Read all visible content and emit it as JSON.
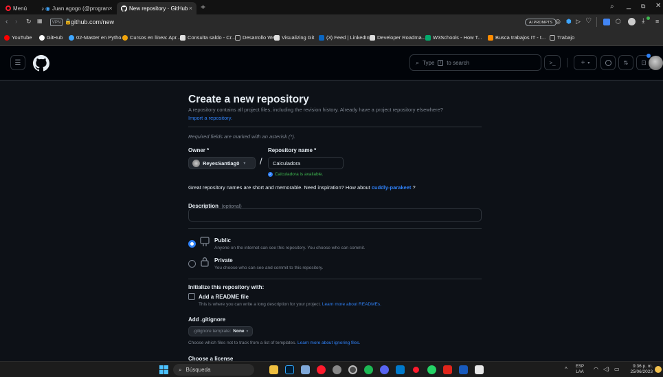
{
  "browser": {
    "menu_label": "Menú",
    "tabs": [
      {
        "label": "Juan agogo (@progran"
      },
      {
        "label": "New repository · GitHub"
      }
    ],
    "url": "github.com/new",
    "vpn_label": "VPN",
    "ai_prompts_label": "AI PROMPTS",
    "bookmarks": [
      {
        "label": "YouTube",
        "color": "#ff0000"
      },
      {
        "label": "GitHub",
        "color": "#ffffff"
      },
      {
        "label": "02-Master en Pytho...",
        "color": "#3ea6ff"
      },
      {
        "label": "Cursos en línea: Apr...",
        "color": "#f0a30a"
      },
      {
        "label": "Consulta saldo - Cr...",
        "color": "#e0e0e0"
      },
      {
        "label": "Desarrollo Web",
        "color": "#bbbbbb"
      },
      {
        "label": "Visualizing Git",
        "color": "#e0e0e0"
      },
      {
        "label": "(3) Feed | LinkedIn",
        "color": "#0a66c2"
      },
      {
        "label": "Developer Roadma...",
        "color": "#dddddd"
      },
      {
        "label": "W3Schools - How T...",
        "color": "#04aa6d"
      },
      {
        "label": "Busca trabajos IT - t...",
        "color": "#ff8c00"
      },
      {
        "label": "Trabajo",
        "color": "#bbbbbb"
      }
    ]
  },
  "github_header": {
    "search_placeholder": "Type / to search",
    "search_prefix": "Type",
    "search_key": "/",
    "search_suffix": "to search"
  },
  "form": {
    "title": "Create a new repository",
    "subtitle": "A repository contains all project files, including the revision history. Already have a project repository elsewhere?",
    "import_link": "Import a repository.",
    "required_note": "Required fields are marked with an asterisk (*).",
    "owner_label": "Owner *",
    "owner_value": "ReyesSantiag0",
    "slash": "/",
    "repo_name_label": "Repository name *",
    "repo_name_value": "Calculadora",
    "available_msg": "Calculadora is available.",
    "suggestion_text": "Great repository names are short and memorable. Need inspiration? How about",
    "suggestion_name": "cuddly-parakeet",
    "suggestion_end": "?",
    "description_label": "Description",
    "description_optional": "(optional)",
    "description_value": "",
    "public_label": "Public",
    "public_desc": "Anyone on the internet can see this repository. You choose who can commit.",
    "private_label": "Private",
    "private_desc": "You choose who can see and commit to this repository.",
    "init_heading": "Initialize this repository with:",
    "readme_label": "Add a README file",
    "readme_desc": "This is where you can write a long description for your project.",
    "readme_link": "Learn more about READMEs.",
    "gitignore_heading": "Add .gitignore",
    "gitignore_prefix": ".gitignore template:",
    "gitignore_value": "None",
    "gitignore_desc": "Choose which files not to track from a list of templates.",
    "gitignore_link": "Learn more about ignoring files.",
    "license_heading": "Choose a license"
  },
  "taskbar": {
    "search_label": "Búsqueda",
    "lang": "ESP",
    "lang_sub": "LAA",
    "time": "9:36 p. m.",
    "date": "25/06/2023"
  },
  "colors": {
    "accent": "#2f81f7",
    "success": "#3fb950",
    "radio_selected": "#2f81f7"
  }
}
